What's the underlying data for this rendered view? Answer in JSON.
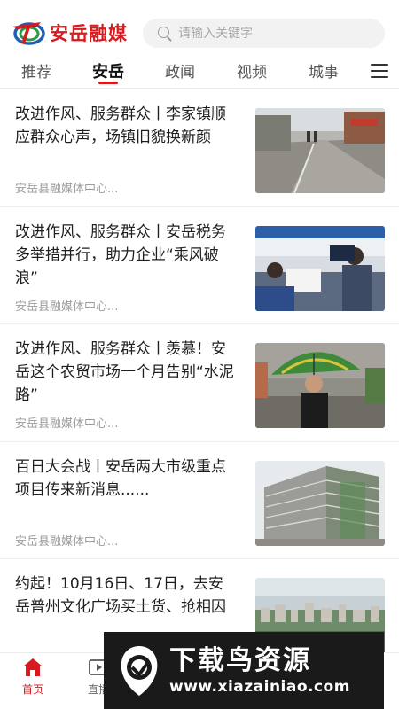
{
  "header": {
    "logo_text": "安岳融媒",
    "search_placeholder": "请输入关键字"
  },
  "tabs": [
    {
      "label": "推荐",
      "active": false
    },
    {
      "label": "安岳",
      "active": true
    },
    {
      "label": "政闻",
      "active": false
    },
    {
      "label": "视频",
      "active": false
    },
    {
      "label": "城事",
      "active": false
    }
  ],
  "news": [
    {
      "title": "改进作风、服务群众丨李家镇顺应群众心声，场镇旧貌换新颜",
      "source": "安岳县融媒体中心..."
    },
    {
      "title": "改进作风、服务群众丨安岳税务多举措并行，助力企业“乘风破浪”",
      "source": "安岳县融媒体中心..."
    },
    {
      "title": "改进作风、服务群众丨羡慕！安岳这个农贸市场一个月告别“水泥路”",
      "source": "安岳县融媒体中心..."
    },
    {
      "title": "百日大会战丨安岳两大市级重点项目传来新消息......",
      "source": "安岳县融媒体中心..."
    },
    {
      "title": "约起！10月16日、17日，去安岳普州文化广场买土货、抢相因",
      "source": ""
    }
  ],
  "bottom_nav": [
    {
      "label": "首页",
      "icon": "home-icon",
      "active": true
    },
    {
      "label": "直播",
      "icon": "live-icon",
      "active": false
    }
  ],
  "watermark": {
    "title": "下载鸟资源",
    "url": "www.xiazainiao.com"
  },
  "colors": {
    "brand_red": "#d8191e",
    "brand_blue": "#1f5fb4",
    "brand_green": "#2a9a45"
  }
}
